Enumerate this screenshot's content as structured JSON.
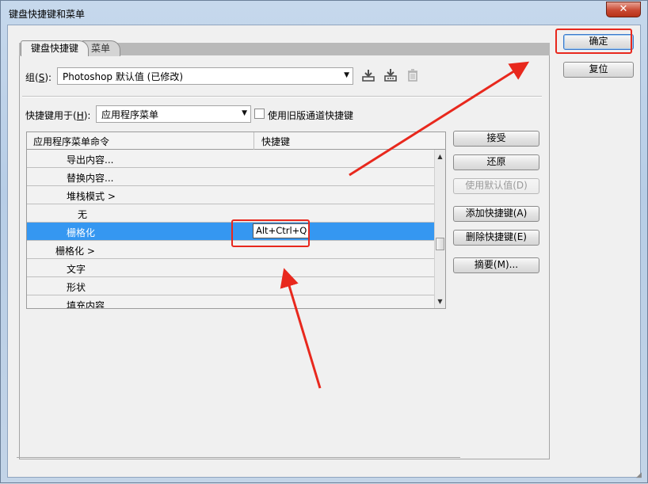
{
  "window": {
    "title": "键盘快捷键和菜单",
    "close_glyph": "✕"
  },
  "tabs": [
    {
      "label": "键盘快捷键",
      "active": true
    },
    {
      "label": "菜单",
      "active": false
    }
  ],
  "group": {
    "label_prefix": "组(",
    "label_key": "S",
    "label_suffix": "):",
    "value": "Photoshop 默认值 (已修改)",
    "icons": [
      "save-set-icon",
      "save-as-icon",
      "delete-icon"
    ]
  },
  "shortcuts_for": {
    "label_prefix": "快捷键用于(",
    "label_key": "H",
    "label_suffix": "):",
    "value": "应用程序菜单",
    "legacy_checkbox_label": "使用旧版通道快捷键",
    "legacy_checked": false
  },
  "table": {
    "headers": [
      "应用程序菜单命令",
      "快捷键"
    ],
    "rows": [
      {
        "command": "导出内容...",
        "shortcut": "",
        "indent": 2
      },
      {
        "command": "替换内容...",
        "shortcut": "",
        "indent": 2
      },
      {
        "command": "堆栈模式 >",
        "shortcut": "",
        "indent": 2
      },
      {
        "command": "无",
        "shortcut": "",
        "indent": 3
      },
      {
        "command": "栅格化",
        "shortcut": "Alt+Ctrl+Q",
        "indent": 2,
        "selected": true
      },
      {
        "command": "栅格化 >",
        "shortcut": "",
        "indent": 1
      },
      {
        "command": "文字",
        "shortcut": "",
        "indent": 2
      },
      {
        "command": "形状",
        "shortcut": "",
        "indent": 2
      },
      {
        "command": "填充内容",
        "shortcut": "",
        "indent": 2
      }
    ]
  },
  "side_buttons": {
    "accept": "接受",
    "undo": "还原",
    "use_default": "使用默认值(D)",
    "add_shortcut": "添加快捷键(A)",
    "delete_shortcut": "删除快捷键(E)",
    "summarize": "摘要(M)..."
  },
  "dialog_buttons": {
    "ok": "确定",
    "reset": "复位"
  },
  "annotation_color": "#e8281d"
}
